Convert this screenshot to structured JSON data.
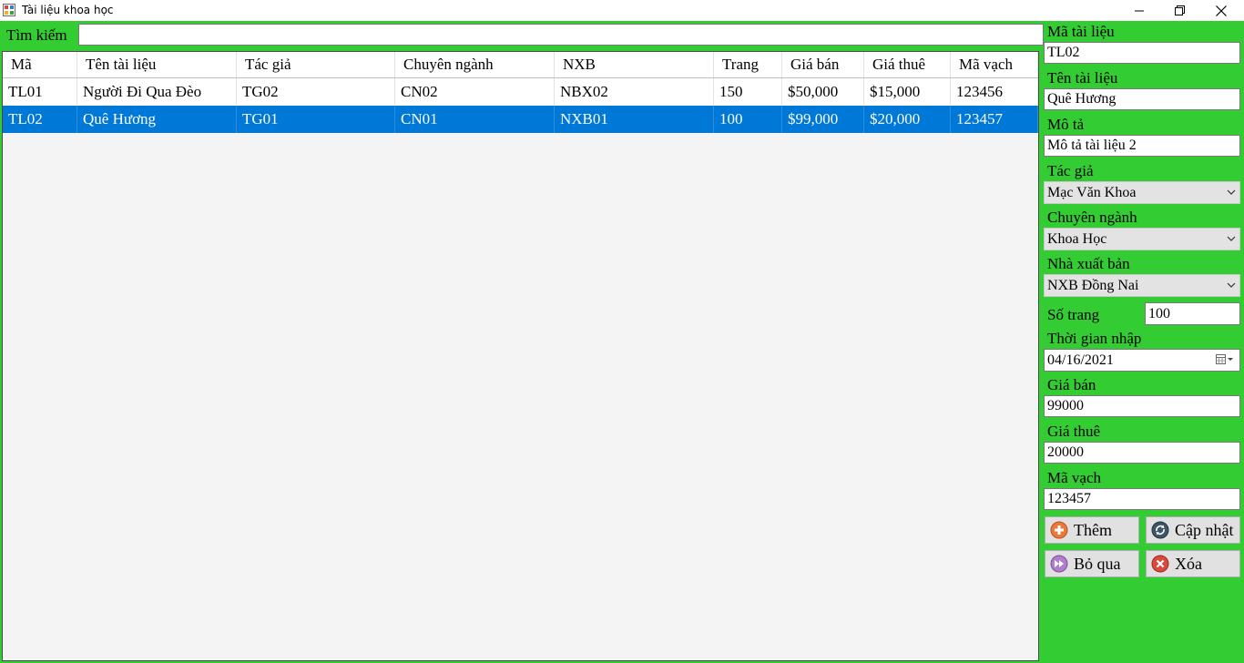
{
  "window": {
    "title": "Tài liệu khoa học"
  },
  "search": {
    "label": "Tìm kiếm",
    "value": ""
  },
  "grid": {
    "columns": [
      "Mã",
      "Tên tài liệu",
      "Tác giả",
      "Chuyên ngành",
      "NXB",
      "Trang",
      "Giá bán",
      "Giá thuê",
      "Mã vạch"
    ],
    "rows": [
      [
        "TL01",
        "Người Đi Qua Đèo",
        "TG02",
        "CN02",
        "NBX02",
        "150",
        "$50,000",
        "$15,000",
        "123456"
      ],
      [
        "TL02",
        "Quê Hương",
        "TG01",
        "CN01",
        "NXB01",
        "100",
        "$99,000",
        "$20,000",
        "123457"
      ]
    ],
    "selected_row": 1
  },
  "form": {
    "ma_tai_lieu": {
      "label": "Mã tài liệu",
      "value": "TL02"
    },
    "ten_tai_lieu": {
      "label": "Tên tài liệu",
      "value": "Quê Hương"
    },
    "mo_ta": {
      "label": "Mô tả",
      "value": "Mô tả tài liệu 2"
    },
    "tac_gia": {
      "label": "Tác giả",
      "value": "Mạc Văn Khoa"
    },
    "chuyen_nganh": {
      "label": "Chuyên ngành",
      "value": "Khoa Học"
    },
    "nha_xuat_ban": {
      "label": "Nhà xuất bản",
      "value": "NXB Đồng Nai"
    },
    "so_trang": {
      "label": "Số trang",
      "value": "100"
    },
    "thoi_gian_nhap": {
      "label": "Thời gian nhập",
      "value": "04/16/2021"
    },
    "gia_ban": {
      "label": "Giá bán",
      "value": "99000"
    },
    "gia_thue": {
      "label": "Giá thuê",
      "value": "20000"
    },
    "ma_vach": {
      "label": "Mã vạch",
      "value": "123457"
    }
  },
  "buttons": {
    "add": "Thêm",
    "update": "Cập nhật",
    "skip": "Bỏ qua",
    "delete": "Xóa"
  },
  "colors": {
    "background": "#33cc33",
    "selection": "#0078d7"
  }
}
